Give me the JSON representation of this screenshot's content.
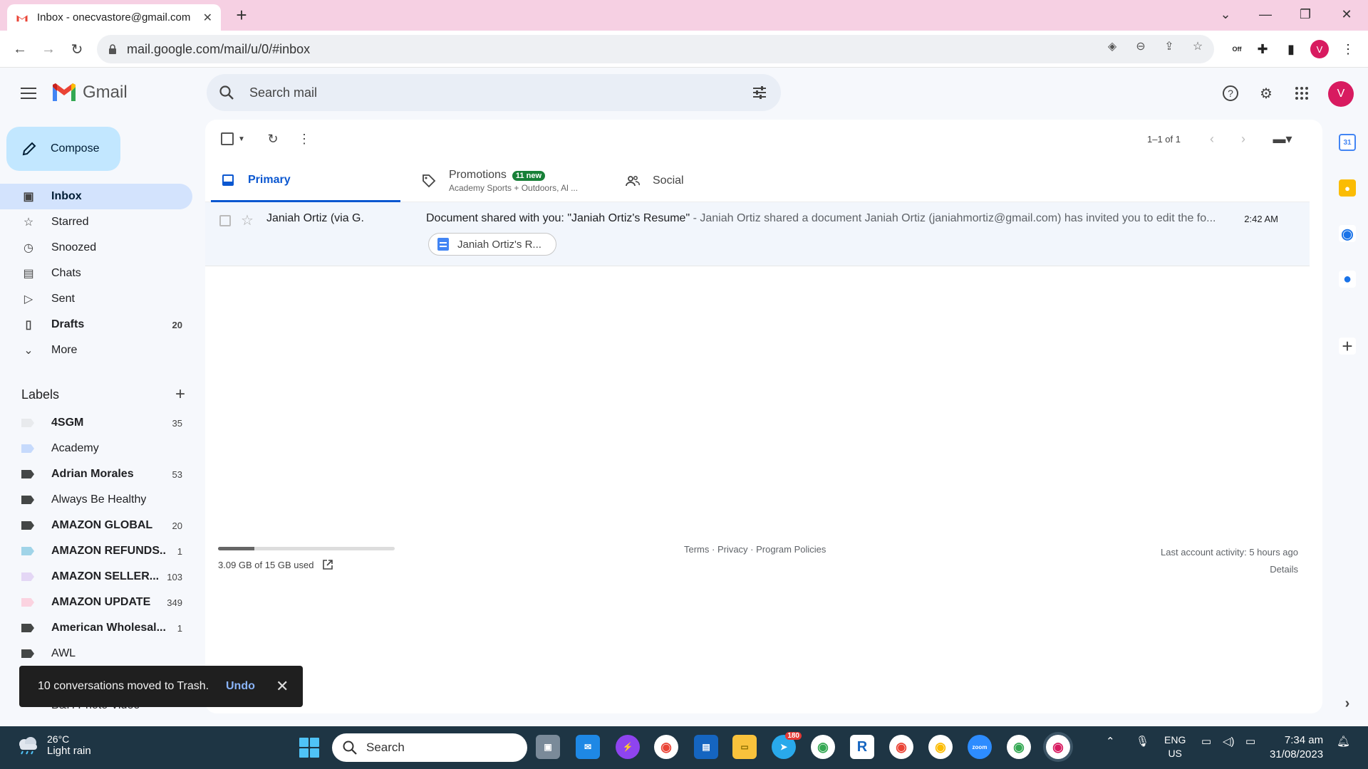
{
  "browser": {
    "tab_title": "Inbox - onecvastore@gmail.com",
    "url": "mail.google.com/mail/u/0/#inbox",
    "profile_initial": "V",
    "extension_badge": "Off"
  },
  "gmail": {
    "brand": "Gmail",
    "search_placeholder": "Search mail",
    "account_initial": "V"
  },
  "compose": {
    "label": "Compose"
  },
  "nav": [
    {
      "label": "Inbox",
      "icon": "inbox-icon",
      "count": ""
    },
    {
      "label": "Starred",
      "icon": "star-icon",
      "count": ""
    },
    {
      "label": "Snoozed",
      "icon": "clock-icon",
      "count": ""
    },
    {
      "label": "Chats",
      "icon": "chat-icon",
      "count": ""
    },
    {
      "label": "Sent",
      "icon": "send-icon",
      "count": ""
    },
    {
      "label": "Drafts",
      "icon": "draft-icon",
      "count": "20"
    },
    {
      "label": "More",
      "icon": "chevron-down-icon",
      "count": ""
    }
  ],
  "labels_header": "Labels",
  "labels": [
    {
      "name": "4SGM",
      "count": "35",
      "color": "#e8eaed",
      "bold": true
    },
    {
      "name": "Academy",
      "count": "",
      "color": "#c6dafc",
      "bold": false
    },
    {
      "name": "Adrian Morales",
      "count": "53",
      "color": "#444746",
      "bold": true
    },
    {
      "name": "Always Be Healthy",
      "count": "",
      "color": "#444746",
      "bold": false
    },
    {
      "name": "AMAZON GLOBAL",
      "count": "20",
      "color": "#444746",
      "bold": true
    },
    {
      "name": "AMAZON REFUNDS...",
      "count": "1",
      "color": "#a0d4e8",
      "bold": true
    },
    {
      "name": "AMAZON SELLER...",
      "count": "103",
      "color": "#e4d7f5",
      "bold": true
    },
    {
      "name": "AMAZON UPDATE",
      "count": "349",
      "color": "#fbd3e0",
      "bold": true
    },
    {
      "name": "American Wholesal...",
      "count": "1",
      "color": "#444746",
      "bold": true
    },
    {
      "name": "AWL",
      "count": "",
      "color": "#444746",
      "bold": false
    }
  ],
  "toolbar": {
    "pager": "1–1 of 1"
  },
  "tabs": [
    {
      "label": "Primary",
      "badge": "",
      "sub": ""
    },
    {
      "label": "Promotions",
      "badge": "11 new",
      "sub": "Academy Sports + Outdoors, Al ..."
    },
    {
      "label": "Social",
      "badge": "",
      "sub": ""
    }
  ],
  "emails": [
    {
      "sender": "Janiah Ortiz (via G.",
      "subject": "Document shared with you: \"Janiah Ortiz's Resume\"",
      "snippet": " - Janiah Ortiz shared a document Janiah Ortiz (janiahmortiz@gmail.com) has invited you to edit the fo...",
      "time": "2:42 AM",
      "attachment": "Janiah Ortiz's R..."
    }
  ],
  "footer": {
    "storage_text": "3.09 GB of 15 GB used",
    "storage_fraction": 0.206,
    "links": "Terms · Privacy · Program Policies",
    "activity": "Last account activity: 5 hours ago",
    "details": "Details"
  },
  "toast": {
    "message": "10 conversations moved to Trash.",
    "undo": "Undo"
  },
  "hidden_label_partial": "B&H Photo Video",
  "taskbar": {
    "temp": "26°C",
    "weather": "Light rain",
    "search": "Search",
    "telegram_badge": "180",
    "lang1": "ENG",
    "lang2": "US",
    "time": "7:34 am",
    "date": "31/08/2023"
  }
}
